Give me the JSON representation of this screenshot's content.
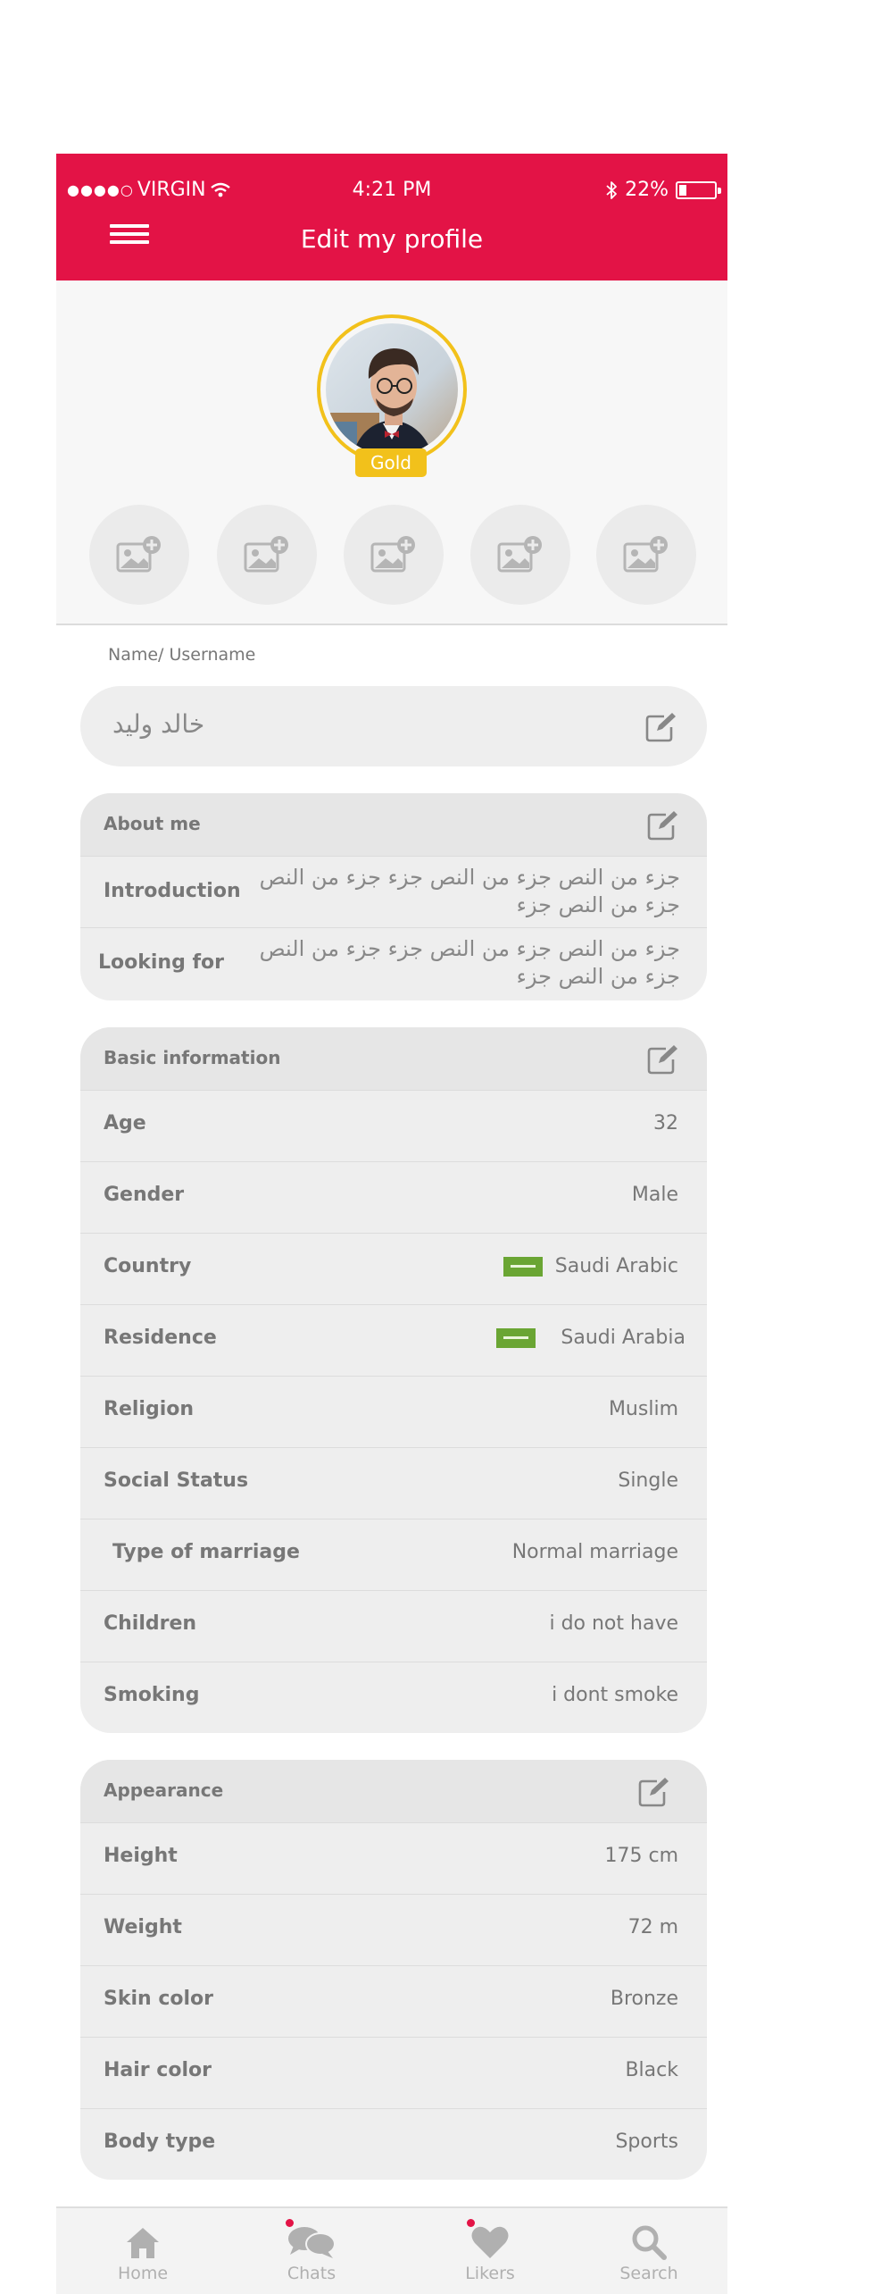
{
  "status_bar": {
    "carrier": "VIRGIN",
    "time": "4:21 PM",
    "battery": "22%",
    "battery_level": 0.22
  },
  "header": {
    "title": "Edit my profile",
    "color": "#e31346"
  },
  "profile": {
    "badge": "Gold",
    "badge_color": "#f2c11b",
    "photo_slots": 5
  },
  "name": {
    "label": "Name/ Username",
    "value": "خالد وليد"
  },
  "about": {
    "title": "About me",
    "rows": [
      {
        "label": "Introduction",
        "value": "جزء من النص جزء من النص جزء جزء من النص جزء من النص جزء"
      },
      {
        "label": "Looking for",
        "value": "جزء من النص جزء من النص جزء جزء من النص جزء من النص جزء"
      }
    ]
  },
  "basic": {
    "title": "Basic information",
    "rows": [
      {
        "label": "Age",
        "value": "32"
      },
      {
        "label": "Gender",
        "value": "Male"
      },
      {
        "label": "Country",
        "value": "Saudi Arabic"
      },
      {
        "label": "Residence",
        "value": "Saudi Arabia"
      },
      {
        "label": "Religion",
        "value": "Muslim"
      },
      {
        "label": "Social Status",
        "value": "Single"
      },
      {
        "label": "Type of marriage",
        "value": "Normal marriage"
      },
      {
        "label": "Children",
        "value": "i do not have"
      },
      {
        "label": "Smoking",
        "value": "i dont smoke"
      }
    ]
  },
  "appearance": {
    "title": "Appearance",
    "rows": [
      {
        "label": "Height",
        "value": "175 cm"
      },
      {
        "label": "Weight",
        "value": "72 m"
      },
      {
        "label": "Skin color",
        "value": "Bronze"
      },
      {
        "label": "Hair color",
        "value": "Black"
      },
      {
        "label": "Body type",
        "value": "Sports"
      }
    ]
  },
  "tabs": {
    "home": "Home",
    "chats": "Chats",
    "likers": "Likers",
    "search": "Search"
  }
}
